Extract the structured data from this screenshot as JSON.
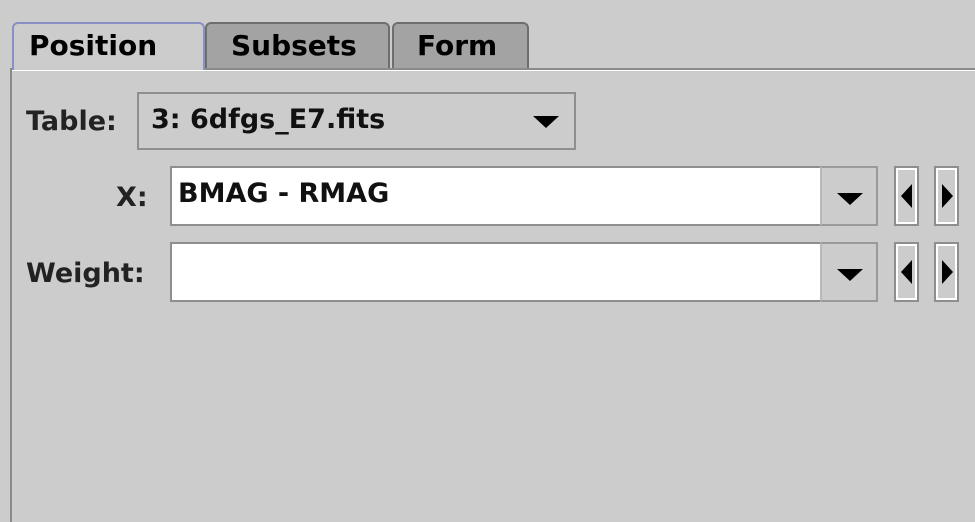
{
  "tabs": [
    {
      "label": "Position",
      "selected": true
    },
    {
      "label": "Subsets",
      "selected": false
    },
    {
      "label": "Form",
      "selected": false
    }
  ],
  "form": {
    "table_label": "Table:",
    "table_value": "3: 6dfgs_E7.fits",
    "x_label": "X:",
    "x_value": "BMAG - RMAG",
    "weight_label": "Weight:",
    "weight_value": ""
  },
  "icons": {
    "dropdown": "triangle-down-icon",
    "previous": "triangle-left-icon",
    "next": "triangle-right-icon"
  },
  "colors": {
    "background": "#cccccc",
    "selected_tab_border": "#8a8fc4",
    "inactive_tab": "#a3a3a3",
    "field_background": "#ffffff"
  }
}
